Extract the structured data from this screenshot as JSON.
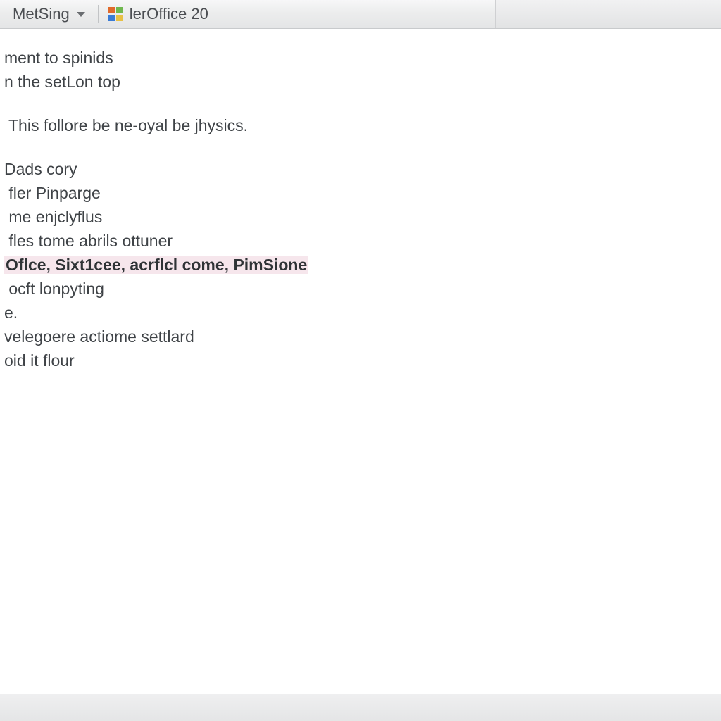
{
  "toolbar": {
    "menu_label": "MetSing",
    "app_label": "lerOffice 20"
  },
  "doc": {
    "block1": [
      "ment to spinids",
      "n the setLon top"
    ],
    "block2": "This follore be ne-oyal be jhysics.",
    "list": [
      {
        "text": "Dads cory"
      },
      {
        "text": " fler Pinparge"
      },
      {
        "text": " me enjclyflus"
      },
      {
        "text": " fles tome abrils ottuner"
      },
      {
        "text": "Oflce, Sixt1cee, acrflcl come, PimSione",
        "highlight": true,
        "bold": true
      },
      {
        "text": " ocft lonpyting"
      },
      {
        "text": "e."
      },
      {
        "text": "velegoere actiome settlard"
      },
      {
        "text": "oid it flour"
      }
    ]
  }
}
